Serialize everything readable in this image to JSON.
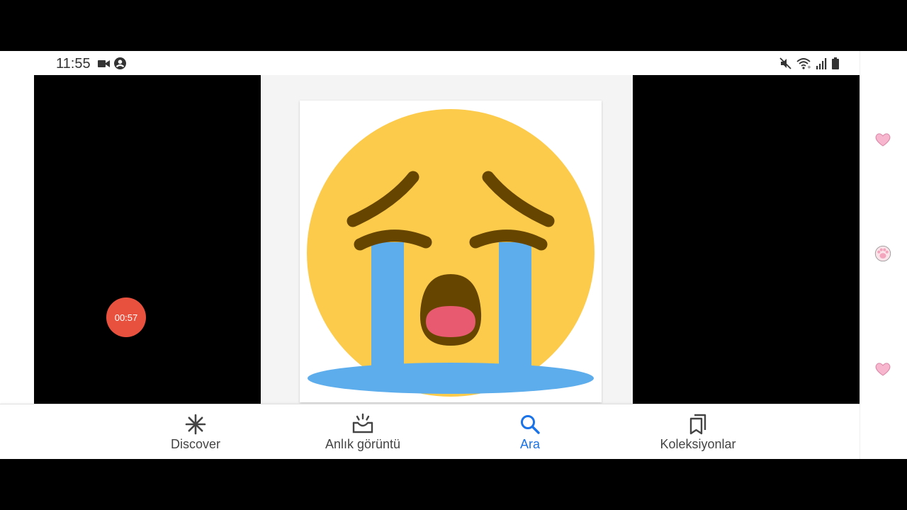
{
  "status_bar": {
    "time": "11:55",
    "left_icons": [
      "video-camera-icon",
      "account-circle-icon"
    ],
    "right_icons": [
      "mute-icon",
      "wifi-icon",
      "cellular-signal-icon",
      "battery-icon"
    ]
  },
  "recording": {
    "timer": "00:57",
    "color": "#e9513f"
  },
  "image": {
    "subject": "loudly-crying-face-emoji"
  },
  "bottom_nav": {
    "items": [
      {
        "label": "Discover",
        "icon": "asterisk-icon",
        "active": false
      },
      {
        "label": "Anlık görüntü",
        "icon": "snapshot-tray-icon",
        "active": false
      },
      {
        "label": "Ara",
        "icon": "search-icon",
        "active": true
      },
      {
        "label": "Koleksiyonlar",
        "icon": "collections-bookmark-icon",
        "active": false
      }
    ],
    "active_color": "#1a73e8"
  },
  "edge_panel": {
    "icons": [
      "heart-icon",
      "paw-icon",
      "heart-icon"
    ]
  }
}
